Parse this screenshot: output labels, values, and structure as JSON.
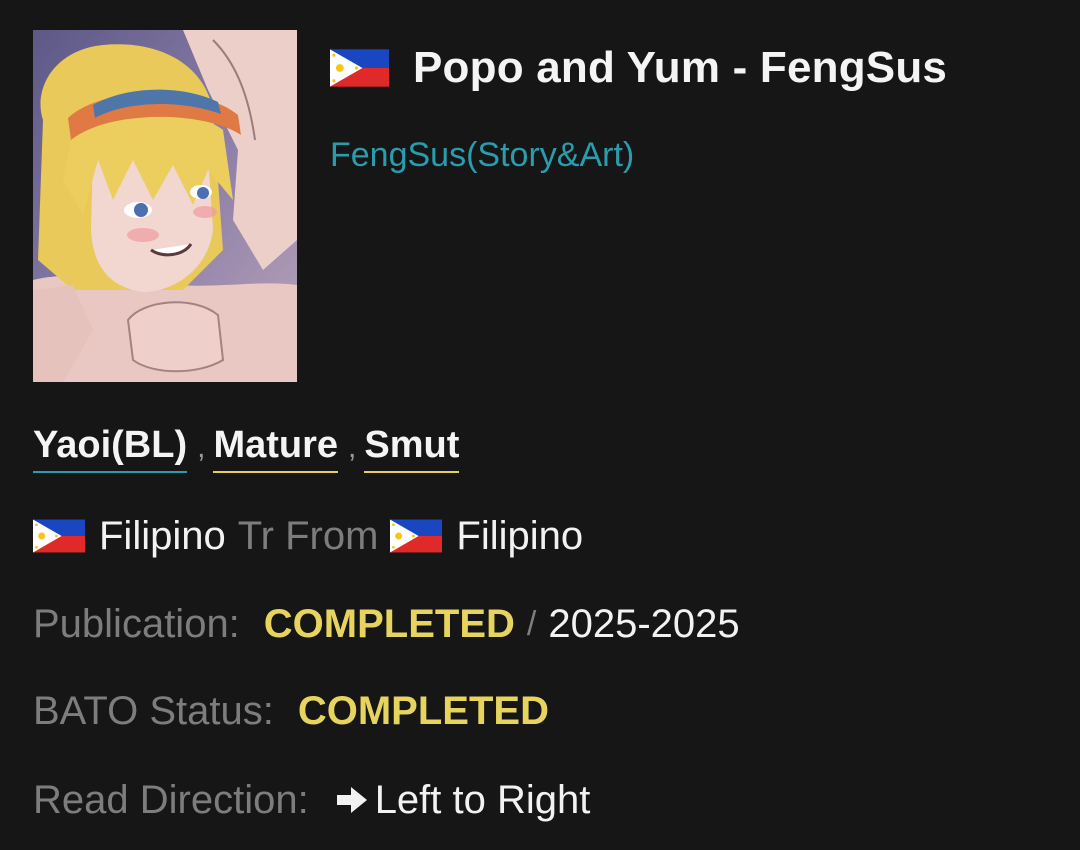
{
  "comic": {
    "title": "Popo and Yum - FengSus",
    "title_flag_icon": "philippines-flag-icon",
    "author": "FengSus(Story&Art)"
  },
  "genres": [
    {
      "label": "Yaoi(BL)",
      "underline_color": "#2a9cad"
    },
    {
      "label": "Mature",
      "underline_color": "#e6d05a"
    },
    {
      "label": "Smut",
      "underline_color": "#e6d05a"
    }
  ],
  "genre_separator": ",",
  "language": {
    "flag_icon": "philippines-flag-icon",
    "tr_language": "Filipino",
    "tr_from_label": "Tr From",
    "original_language": "Filipino"
  },
  "publication": {
    "label": "Publication:",
    "status": "COMPLETED",
    "separator": "/",
    "years": "2025-2025"
  },
  "bato_status": {
    "label": "BATO Status:",
    "status": "COMPLETED"
  },
  "read_direction": {
    "label": "Read Direction:",
    "icon": "right-arrow-icon",
    "value": "Left to Right"
  },
  "colors": {
    "background": "#161616",
    "link": "#2a9cad",
    "status": "#e7d45e",
    "muted": "#7d7d7d"
  }
}
